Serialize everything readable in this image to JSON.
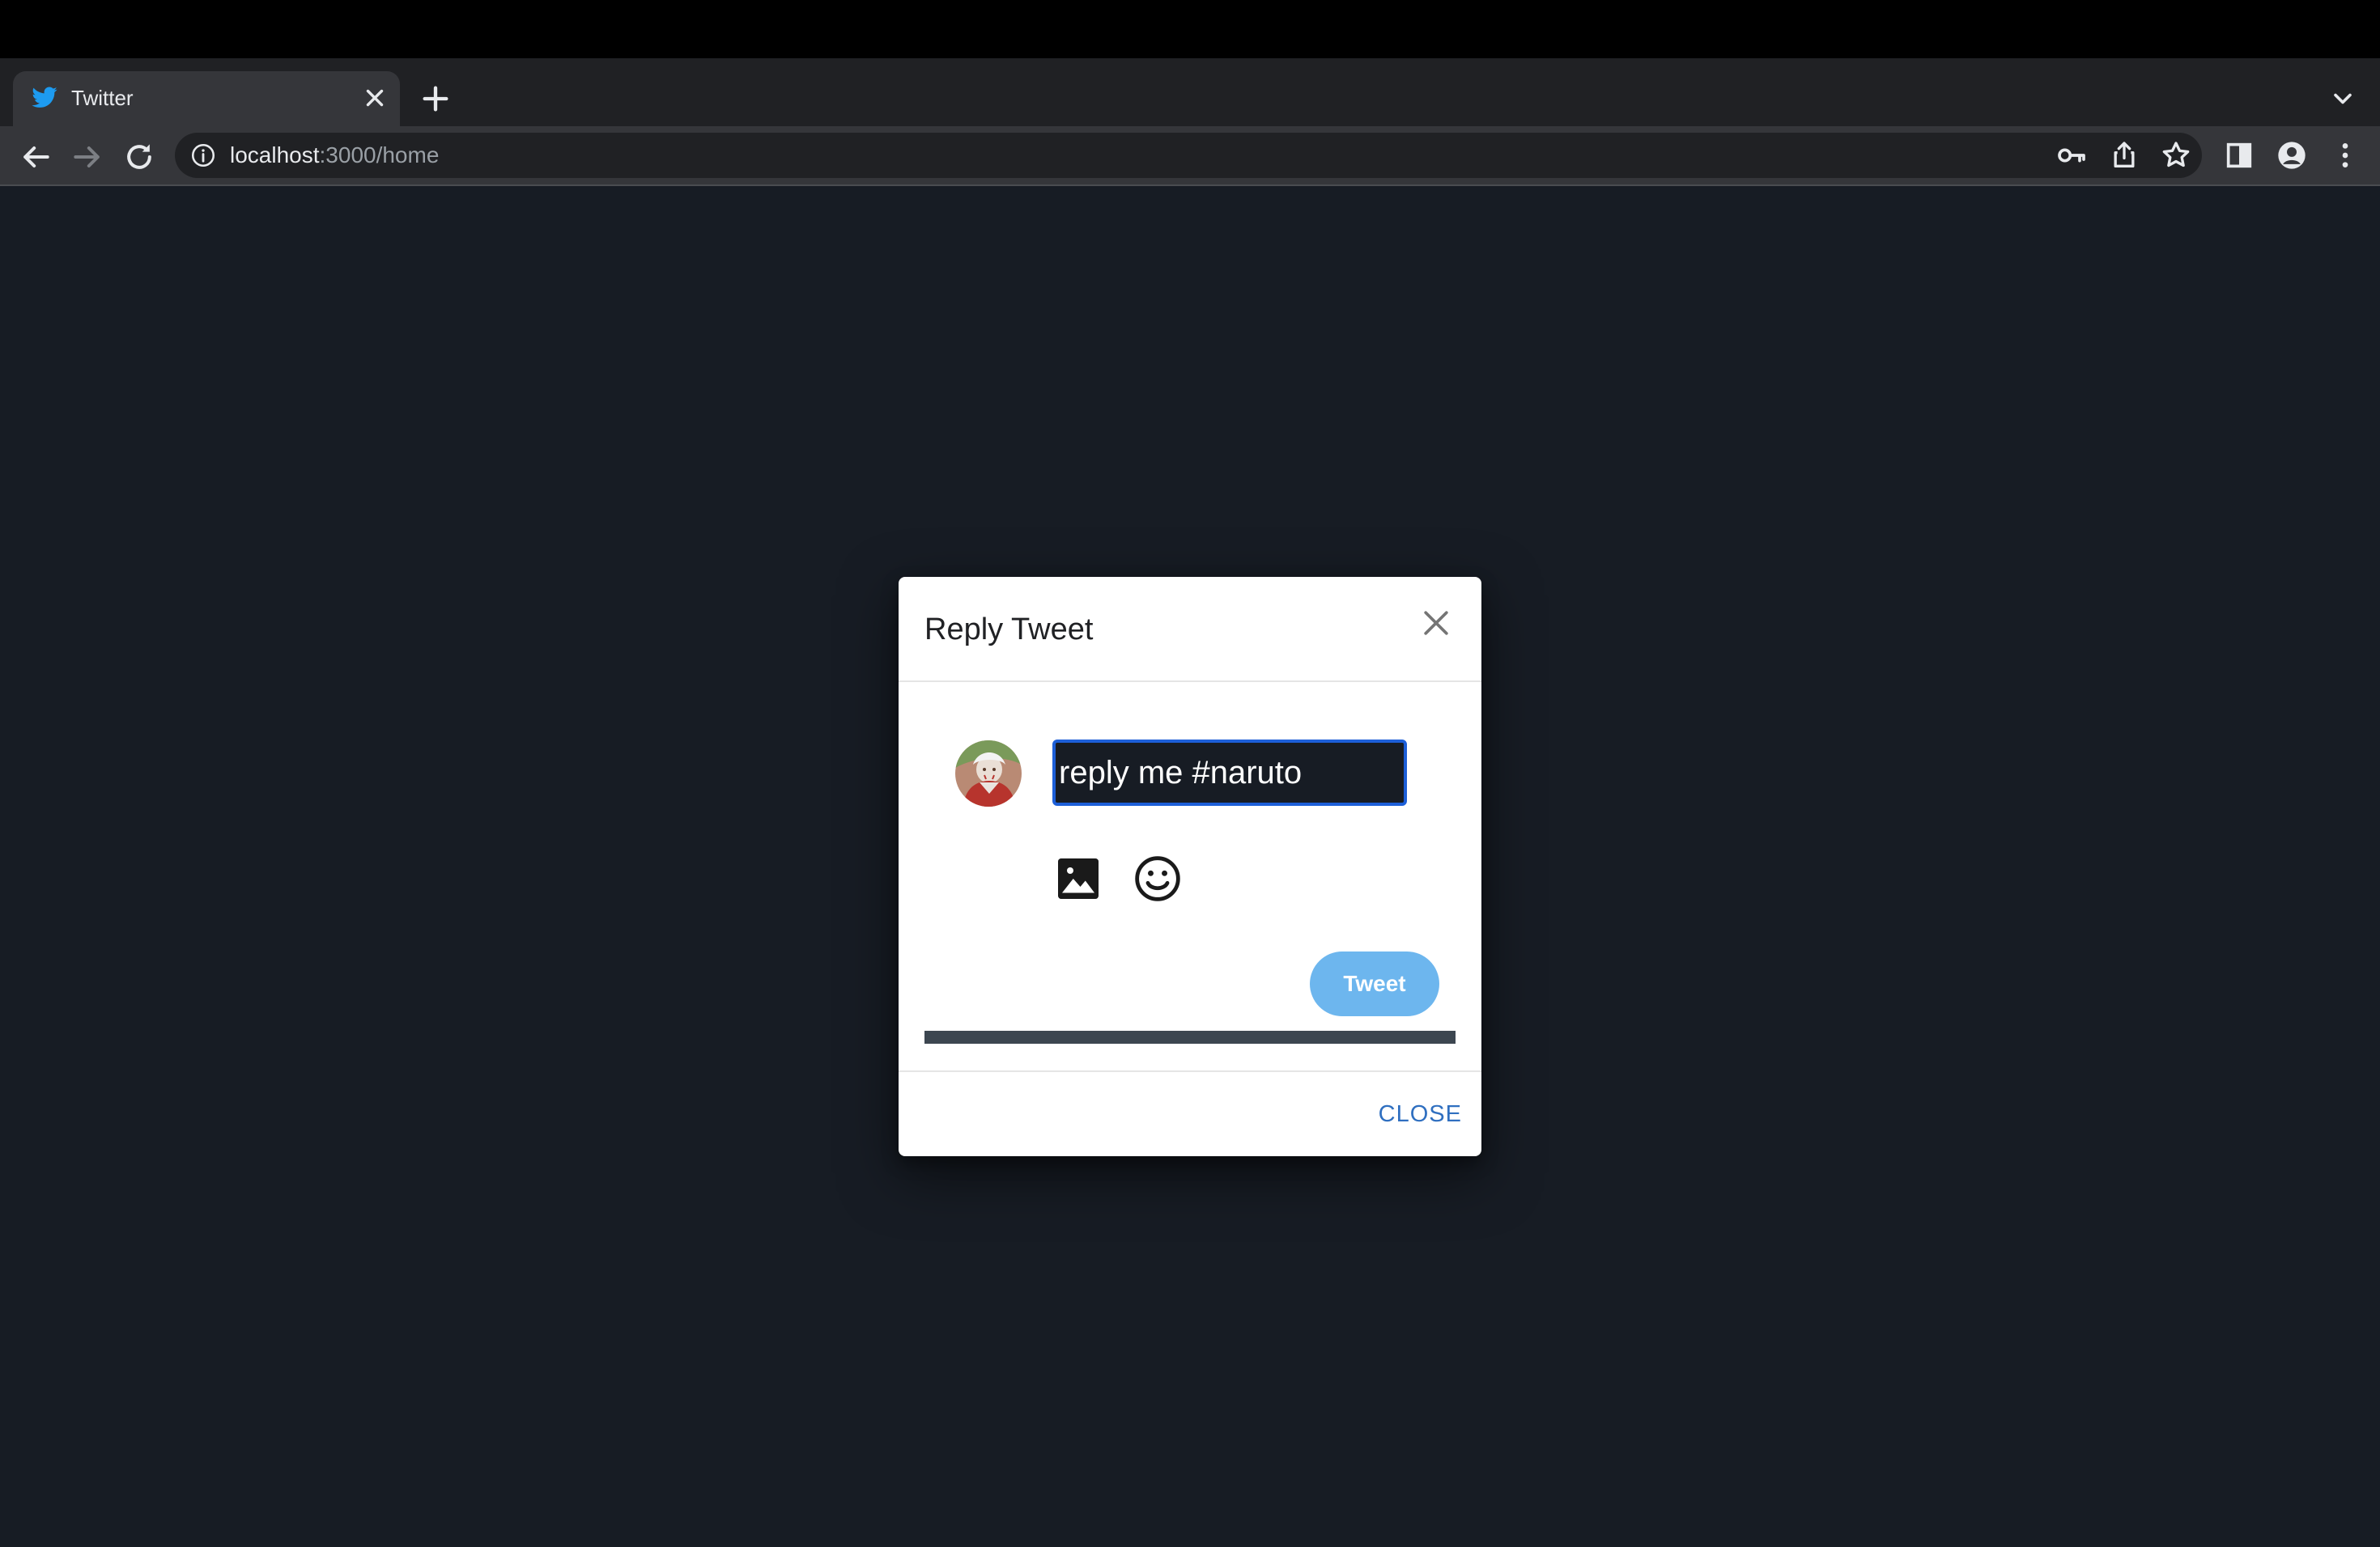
{
  "browser": {
    "tab": {
      "title": "Twitter",
      "favicon": "twitter-bird-icon"
    },
    "address_bar": {
      "host": "localhost",
      "path": ":3000/home"
    },
    "toolbar_icons": [
      "back-icon",
      "forward-icon",
      "reload-icon",
      "site-info-icon",
      "key-icon",
      "share-icon",
      "star-icon",
      "side-panel-icon",
      "profile-icon",
      "more-menu-icon"
    ]
  },
  "dialog": {
    "title": "Reply Tweet",
    "input_value": "reply me #naruto",
    "media_icons": [
      "image-icon",
      "emoji-icon"
    ],
    "tweet_label": "Tweet",
    "close_label": "CLOSE",
    "progress": 1.0
  },
  "colors": {
    "page_background": "#171c24",
    "dialog_background": "#ffffff",
    "tweet_button": "#6db6ee",
    "close_text": "#2f6fc0",
    "input_border": "#1d5fd8",
    "progress_bar": "#3c4650"
  }
}
